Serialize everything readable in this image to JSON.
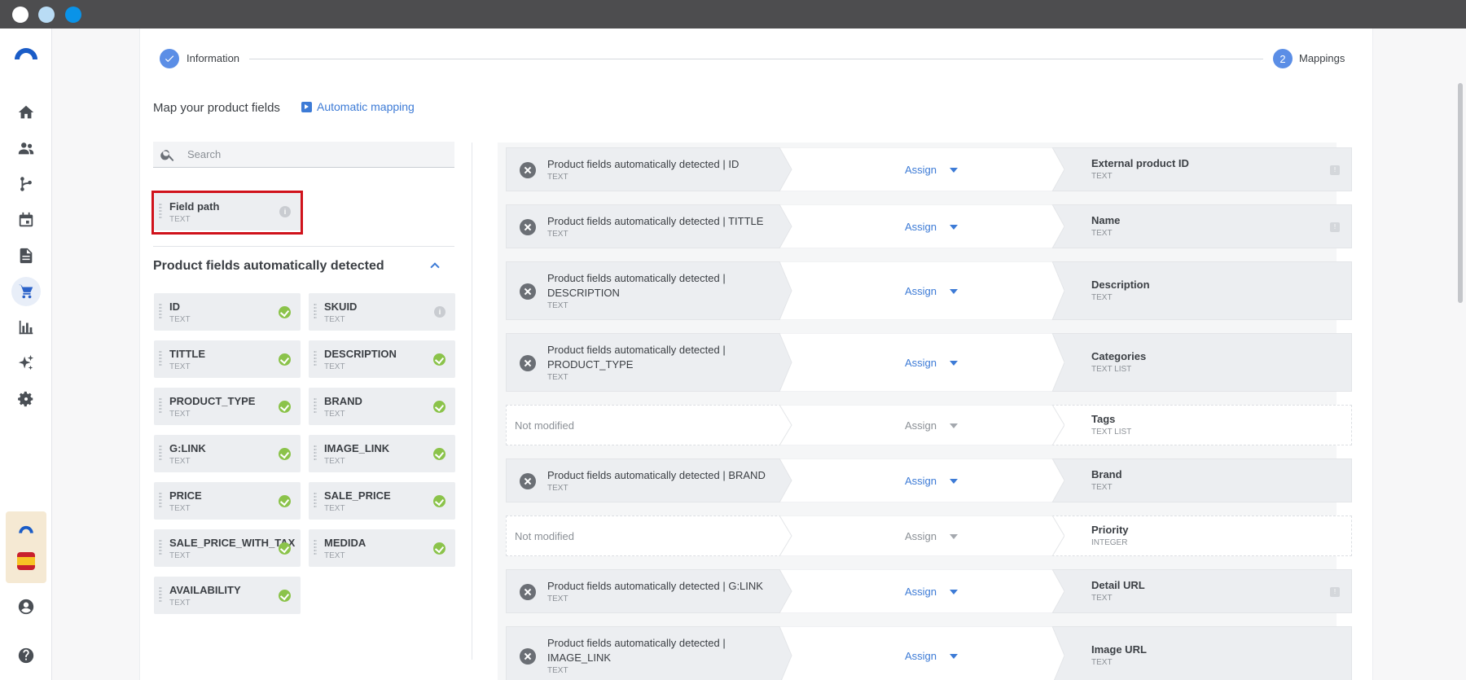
{
  "stepper": {
    "step1_label": "Information",
    "step2_number": "2",
    "step2_label": "Mappings"
  },
  "header": {
    "title": "Map your product fields",
    "auto_mapping_label": "Automatic mapping"
  },
  "search": {
    "placeholder": "Search"
  },
  "field_path": {
    "name": "Field path",
    "type": "TEXT"
  },
  "detected": {
    "title": "Product fields automatically detected",
    "fields": [
      {
        "name": "ID",
        "type": "TEXT",
        "status": "mapped"
      },
      {
        "name": "SKUID",
        "type": "TEXT",
        "status": "info"
      },
      {
        "name": "TITTLE",
        "type": "TEXT",
        "status": "mapped"
      },
      {
        "name": "DESCRIPTION",
        "type": "TEXT",
        "status": "mapped"
      },
      {
        "name": "PRODUCT_TYPE",
        "type": "TEXT",
        "status": "mapped"
      },
      {
        "name": "BRAND",
        "type": "TEXT",
        "status": "mapped"
      },
      {
        "name": "G:LINK",
        "type": "TEXT",
        "status": "mapped"
      },
      {
        "name": "IMAGE_LINK",
        "type": "TEXT",
        "status": "mapped"
      },
      {
        "name": "PRICE",
        "type": "TEXT",
        "status": "mapped"
      },
      {
        "name": "SALE_PRICE",
        "type": "TEXT",
        "status": "mapped"
      },
      {
        "name": "SALE_PRICE_WITH_TAX",
        "type": "TEXT",
        "status": "mapped"
      },
      {
        "name": "MEDIDA",
        "type": "TEXT",
        "status": "mapped"
      },
      {
        "name": "AVAILABILITY",
        "type": "TEXT",
        "status": "mapped"
      }
    ]
  },
  "mappings": [
    {
      "source": "Product fields automatically detected | ID",
      "source_type": "TEXT",
      "assign": "Assign",
      "target": "External product ID",
      "target_type": "TEXT",
      "modified": true,
      "badge": true
    },
    {
      "source": "Product fields automatically detected | TITTLE",
      "source_type": "TEXT",
      "assign": "Assign",
      "target": "Name",
      "target_type": "TEXT",
      "modified": true,
      "badge": true
    },
    {
      "source": "Product fields automatically detected | DESCRIPTION",
      "source_type": "TEXT",
      "assign": "Assign",
      "target": "Description",
      "target_type": "TEXT",
      "modified": true,
      "badge": false
    },
    {
      "source": "Product fields automatically detected | PRODUCT_TYPE",
      "source_type": "TEXT",
      "assign": "Assign",
      "target": "Categories",
      "target_type": "TEXT LIST",
      "modified": true,
      "badge": false
    },
    {
      "source": "Not modified",
      "source_type": "",
      "assign": "Assign",
      "target": "Tags",
      "target_type": "TEXT LIST",
      "modified": false,
      "badge": false
    },
    {
      "source": "Product fields automatically detected | BRAND",
      "source_type": "TEXT",
      "assign": "Assign",
      "target": "Brand",
      "target_type": "TEXT",
      "modified": true,
      "badge": false
    },
    {
      "source": "Not modified",
      "source_type": "",
      "assign": "Assign",
      "target": "Priority",
      "target_type": "INTEGER",
      "modified": false,
      "badge": false
    },
    {
      "source": "Product fields automatically detected | G:LINK",
      "source_type": "TEXT",
      "assign": "Assign",
      "target": "Detail URL",
      "target_type": "TEXT",
      "modified": true,
      "badge": true
    },
    {
      "source": "Product fields automatically detected | IMAGE_LINK",
      "source_type": "TEXT",
      "assign": "Assign",
      "target": "Image URL",
      "target_type": "TEXT",
      "modified": true,
      "badge": false
    }
  ],
  "nav": {
    "items": [
      "home-icon",
      "people-icon",
      "workflow-icon",
      "calendar-icon",
      "document-icon",
      "cart-icon",
      "chart-icon",
      "sparkle-icon",
      "settings-icon"
    ],
    "bottom": [
      "account-icon",
      "help-icon"
    ],
    "active": "cart-icon"
  },
  "colors": {
    "accent": "#3d7bd6",
    "brand": "#1a5cc7",
    "success": "#8bc34a",
    "highlight": "#d0121b",
    "titlebar": "#4d4d4f"
  }
}
